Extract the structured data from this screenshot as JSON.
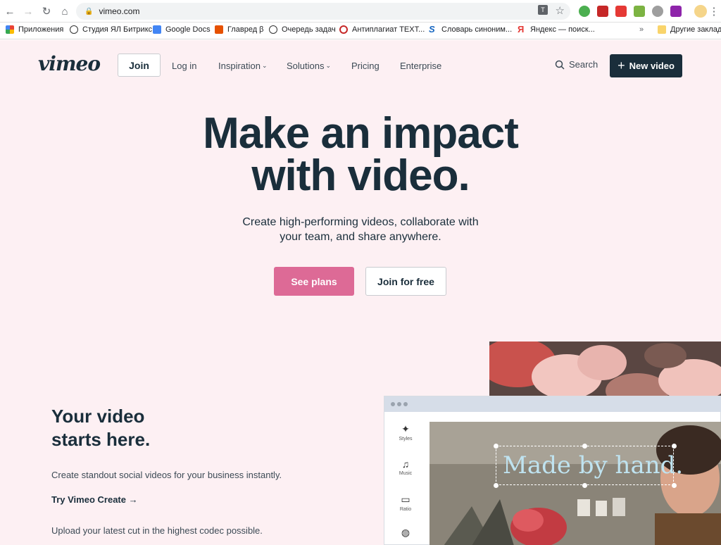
{
  "browser": {
    "url": "vimeo.com",
    "bookmarks": [
      "Приложения",
      "Студия ЯЛ Битрикс",
      "Google Docs",
      "Главред β",
      "Очередь задач",
      "Антиплагиат TEXT...",
      "Словарь синоним...",
      "Яндекс — поиск...",
      "Другие закладки"
    ]
  },
  "nav": {
    "logo": "vimeo",
    "join": "Join",
    "login": "Log in",
    "inspiration": "Inspiration",
    "solutions": "Solutions",
    "pricing": "Pricing",
    "enterprise": "Enterprise",
    "search": "Search",
    "new_video": "New video"
  },
  "hero": {
    "title_line1": "Make an impact",
    "title_line2": "with video.",
    "subtitle_line1": "Create high-performing videos, collaborate with",
    "subtitle_line2": "your team, and share anywhere.",
    "see_plans": "See plans",
    "join_free": "Join for free"
  },
  "section": {
    "title_line1": "Your video",
    "title_line2": "starts here.",
    "text": "Create standout social videos for your business instantly.",
    "link": "Try Vimeo Create",
    "text2": "Upload your latest cut in the highest codec possible."
  },
  "editor": {
    "tools": [
      "Styles",
      "Music",
      "Ratio"
    ],
    "overlay_text": "Made by hand."
  },
  "colors": {
    "page_bg": "#fdf0f3",
    "primary_dark": "#1a2e3b",
    "accent_pink": "#dd6a96"
  }
}
